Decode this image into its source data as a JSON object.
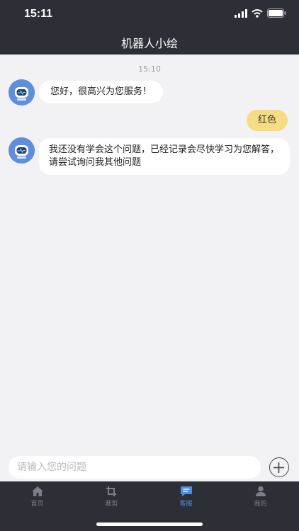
{
  "status_bar": {
    "time": "15:11"
  },
  "header": {
    "title": "机器人小绘"
  },
  "chat": {
    "timestamp": "15:10",
    "messages": [
      {
        "from": "bot",
        "text": "您好，很高兴为您服务！"
      },
      {
        "from": "user",
        "text": "红色"
      },
      {
        "from": "bot",
        "text": "我还没有学会这个问题，已经记录会尽快学习为您解答，请尝试询问我其他问题"
      }
    ]
  },
  "input": {
    "placeholder": "请输入您的问题",
    "value": ""
  },
  "tab_bar": {
    "active": "客服",
    "active_color": "#4a90e2",
    "items": [
      {
        "label": "首页",
        "icon": "home-icon"
      },
      {
        "label": "裁剪",
        "icon": "crop-icon"
      },
      {
        "label": "客服",
        "icon": "chat-icon"
      },
      {
        "label": "我的",
        "icon": "user-icon"
      }
    ]
  },
  "colors": {
    "bar_background": "#2c2f36",
    "chat_background": "#f2f2f4",
    "user_bubble": "#f6dc85",
    "bot_bubble": "#ffffff"
  }
}
